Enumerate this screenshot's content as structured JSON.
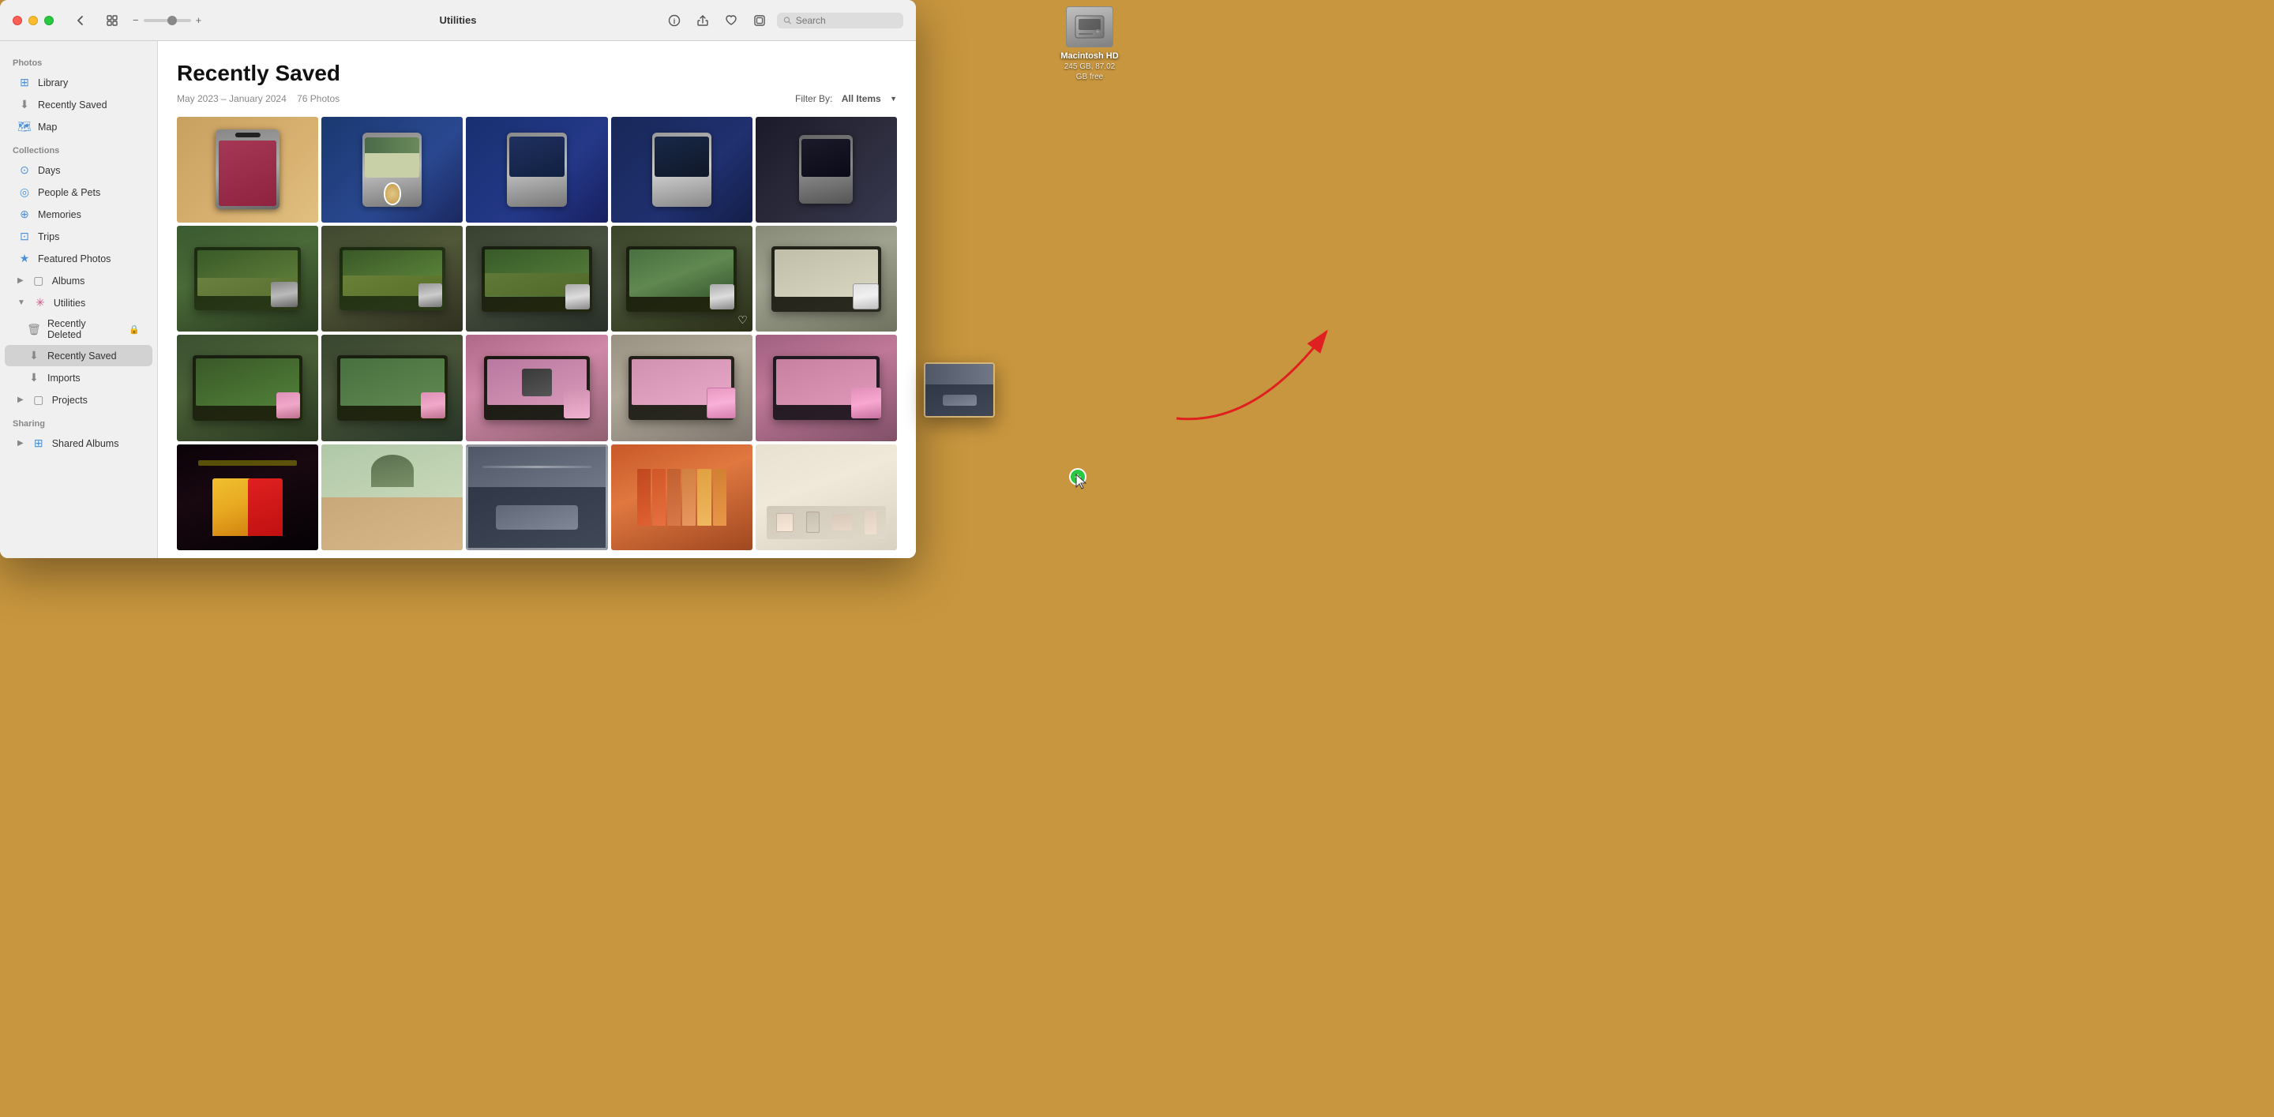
{
  "window": {
    "title": "Utilities"
  },
  "titlebar": {
    "back_btn": "‹",
    "display_btn": "⊞",
    "zoom_minus": "−",
    "zoom_plus": "+",
    "title": "Utilities",
    "info_btn": "ⓘ",
    "share_btn": "↑",
    "heart_btn": "♡",
    "crop_btn": "⊡",
    "search_placeholder": "Search"
  },
  "sidebar": {
    "photos_section": "Photos",
    "library": "Library",
    "recently_saved": "Recently Saved",
    "map": "Map",
    "collections_section": "Collections",
    "days": "Days",
    "people_pets": "People & Pets",
    "memories": "Memories",
    "trips": "Trips",
    "featured_photos": "Featured Photos",
    "albums": "Albums",
    "utilities_section": "Utilities",
    "recently_deleted": "Recently Deleted",
    "recently_saved_util": "Recently Saved",
    "imports": "Imports",
    "projects": "Projects",
    "sharing_section": "Sharing",
    "shared_albums": "Shared Albums"
  },
  "content": {
    "title": "Recently Saved",
    "date_range": "May 2023 – January 2024",
    "photo_count": "76 Photos",
    "filter_label": "Filter By:",
    "filter_value": "All Items",
    "filter_chevron": "▼"
  },
  "desktop": {
    "hdd_name": "Macintosh HD",
    "hdd_info": "245 GB, 87.02 GB free"
  },
  "photos": {
    "rows": [
      [
        "hand_phone_brown",
        "hand_phone_dog",
        "hand_phone_blue1",
        "hand_phone_blue2",
        "hand_phone_dark"
      ],
      [
        "laptop_green1",
        "laptop_green2",
        "laptop_green3",
        "laptop_green4",
        "laptop_white"
      ],
      [
        "laptop_phone_left",
        "laptop_phone2",
        "pink_phone_laptop",
        "pink_case1",
        "pink_case2"
      ],
      [
        "stage_dark",
        "interior_warm",
        "car_sunset",
        "colorful_rolls",
        "white_shelf"
      ]
    ]
  }
}
